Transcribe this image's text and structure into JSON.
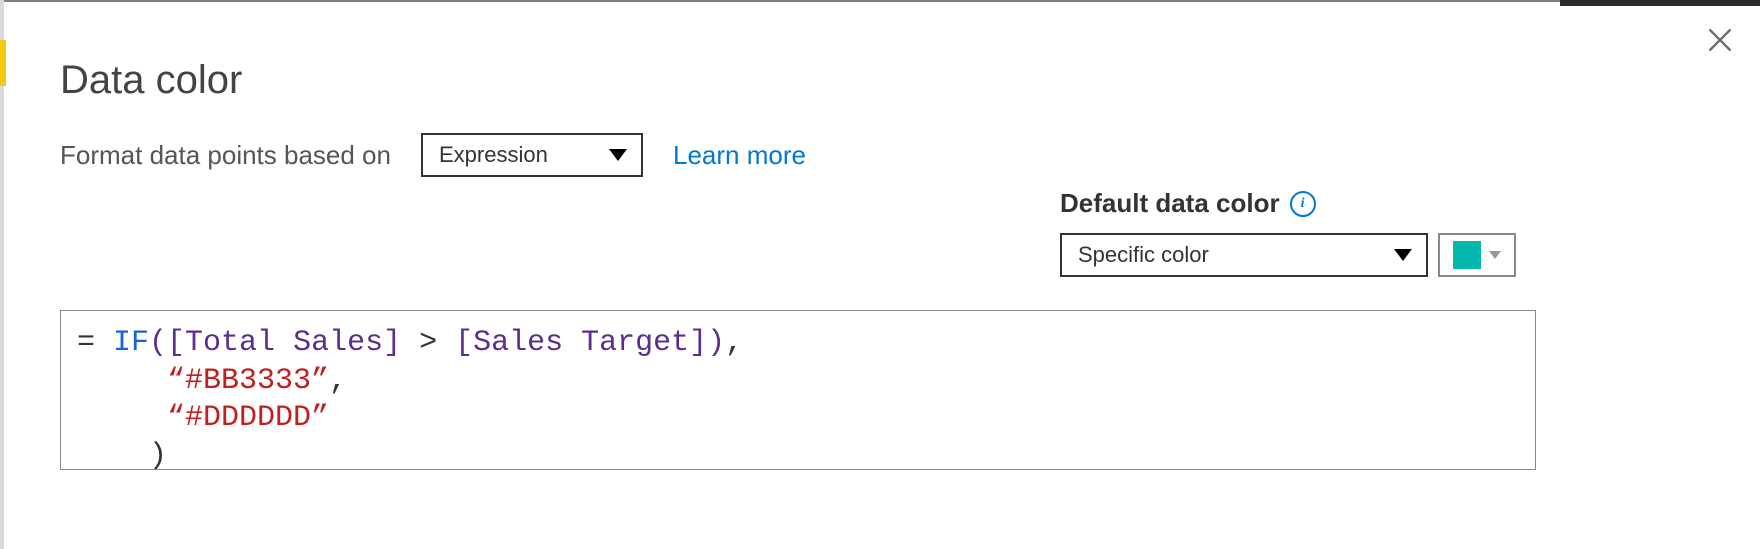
{
  "dialog": {
    "title": "Data color",
    "format_label": "Format data points based on",
    "format_dropdown_value": "Expression",
    "learn_more": "Learn more"
  },
  "default_color": {
    "label": "Default data color",
    "dropdown_value": "Specific color",
    "swatch_hex": "#01B8AA",
    "info_glyph": "i"
  },
  "expression": {
    "prefix": "= ",
    "keyword": "IF",
    "open_paren": "(",
    "field1": "[Total Sales]",
    "op_gt": " > ",
    "field2": "[Sales Target]",
    "close_paren1": ")",
    "comma1": ",",
    "indent": "     ",
    "string1": "“#BB3333”",
    "comma2": ",",
    "string2": "“#DDDDDD”",
    "final_indent": "    ",
    "final_close": ")"
  }
}
